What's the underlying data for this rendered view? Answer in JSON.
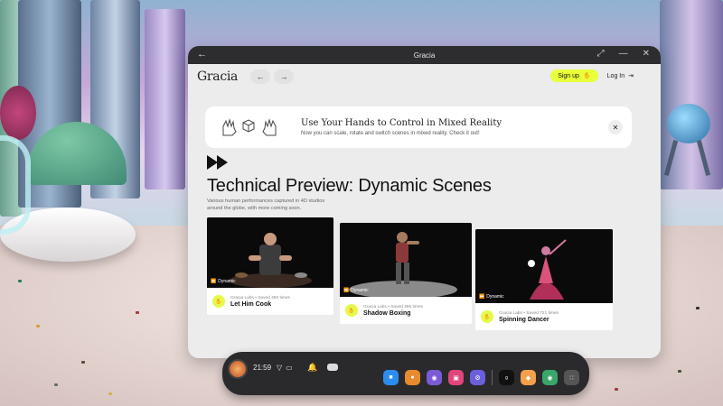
{
  "window": {
    "title": "Gracia",
    "back_icon": "arrow-left-icon",
    "controls": [
      "resize-icon",
      "minimize-icon",
      "close-icon"
    ]
  },
  "navbar": {
    "logo": "Gracia",
    "back_arrow": "←",
    "forward_arrow": "→",
    "signup_label": "Sign up",
    "login_label": "Log In",
    "accent_color": "#e8ff3a"
  },
  "banner": {
    "title": "Use Your Hands to Control in Mixed Reality",
    "subtitle": "Now you can scale, rotate and switch scenes in mixed reality. Check it out!",
    "close_icon": "close-icon"
  },
  "main": {
    "title": "Technical Preview: Dynamic Scenes",
    "description": "Various human performances captured in 4D studios around the globe, with more coming soon.",
    "cards": [
      {
        "badge": "Dynamic",
        "owner": "Gracia Labs • Saved 460 times",
        "title": "Let Him Cook"
      },
      {
        "badge": "Dynamic",
        "owner": "Gracia Labs • Saved 485 times",
        "title": "Shadow Boxing"
      },
      {
        "badge": "Dynamic",
        "owner": "Gracia Labs • Saved 721 times",
        "title": "Spinning Dancer"
      }
    ]
  },
  "dock": {
    "time": "21:59",
    "apps": [
      "store-icon",
      "bag-icon",
      "people-icon",
      "camera-icon",
      "settings-icon",
      "gracia-icon",
      "browser-icon",
      "meta-icon",
      "grid-icon"
    ]
  }
}
